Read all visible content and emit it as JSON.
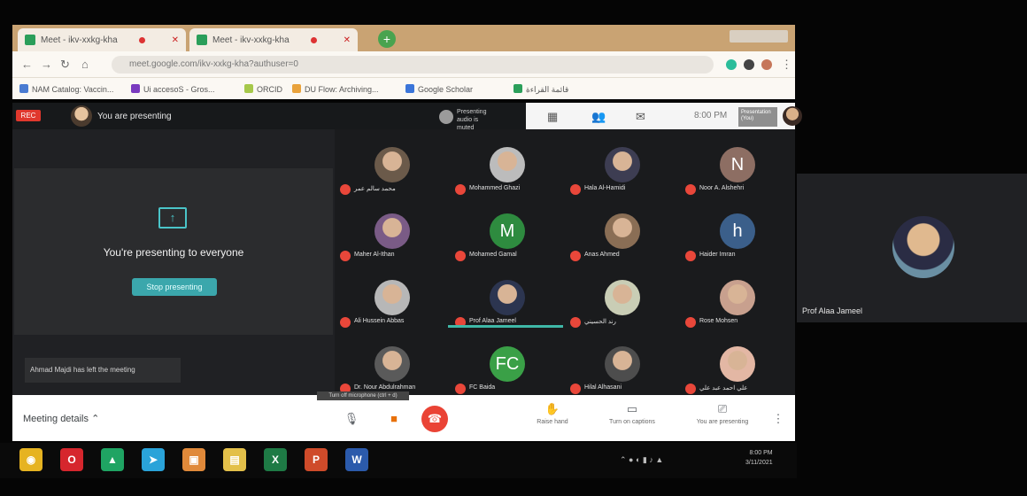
{
  "browser": {
    "tabs": [
      {
        "title": "Meet - ikv-xxkg-kha"
      },
      {
        "title": "Meet - ikv-xxkg-kha"
      }
    ],
    "new_tab_label": "+",
    "url": "meet.google.com/ikv-xxkg-kha?authuser=0",
    "bookmarks": [
      {
        "label": "NAM Catalog: Vaccin...",
        "color": "#4a7bd1"
      },
      {
        "label": "Ui accesoS - Gros...",
        "color": "#7a3bbf"
      },
      {
        "label": "ORCID",
        "color": "#a6c84a"
      },
      {
        "label": "DU Flow: Archiving...",
        "color": "#e9a23b"
      },
      {
        "label": "Google Scholar",
        "color": "#3b75d9"
      },
      {
        "label": "قائمة القراءة",
        "color": "#2b9f5a"
      }
    ]
  },
  "meet": {
    "rec_label": "REC",
    "presenting_header": "You are presenting",
    "audio_chip": "Presenting audio is muted",
    "clock": "8:00 PM",
    "presentation_chip": "Presentation (You)",
    "present_message": "You're presenting to everyone",
    "stop_button": "Stop presenting",
    "toast": "Ahmad Majdi has left the meeting",
    "meeting_details": "Meeting details",
    "tooltip": "Turn off microphone (ctrl + d)",
    "right_labels": {
      "raise": "Raise hand",
      "captions": "Turn on captions",
      "present": "You are presenting"
    },
    "pinned_name": "Prof Alaa Jameel",
    "participants": [
      {
        "name": "محمد سالم عمر",
        "letter": "",
        "bg": "#6b5a4a"
      },
      {
        "name": "Mohammed Ghazi",
        "letter": "",
        "bg": "#bcbcbc"
      },
      {
        "name": "Hala Al-Hamidi",
        "letter": "",
        "bg": "#3d3d52"
      },
      {
        "name": "Noor A. Alshehri",
        "letter": "N",
        "bg": "#8d6e63"
      },
      {
        "name": "Maher Al-Ithan",
        "letter": "",
        "bg": "#7a5b86"
      },
      {
        "name": "Mohamed Gamal",
        "letter": "M",
        "bg": "#2e8b3f"
      },
      {
        "name": "Anas Ahmed",
        "letter": "",
        "bg": "#8a6e55"
      },
      {
        "name": "Haider Imran",
        "letter": "h",
        "bg": "#3b5f8a"
      },
      {
        "name": "Ali Hussein Abbas",
        "letter": "",
        "bg": "#b7b7b7"
      },
      {
        "name": "Prof Alaa Jameel",
        "letter": "",
        "bg": "#2c3550"
      },
      {
        "name": "رند الحسيني",
        "letter": "",
        "bg": "#c9cdb5"
      },
      {
        "name": "Rose Mohsen",
        "letter": "",
        "bg": "#c8a08e"
      },
      {
        "name": "Dr. Nour Abdulrahman",
        "letter": "",
        "bg": "#5a5a5a"
      },
      {
        "name": "FC Baida",
        "letter": "FC",
        "bg": "#3aa047"
      },
      {
        "name": "Hilal Alhasani",
        "letter": "",
        "bg": "#4d4d4d"
      },
      {
        "name": "علي احمد عبد علي",
        "letter": "",
        "bg": "#e3b7a4"
      }
    ]
  },
  "taskbar": {
    "apps": [
      {
        "icon": "chrome-icon",
        "color": "#e6b321"
      },
      {
        "icon": "opera-icon",
        "color": "#d6262d"
      },
      {
        "icon": "drive-icon",
        "color": "#1fa463"
      },
      {
        "icon": "telegram-icon",
        "color": "#2aa3d9"
      },
      {
        "icon": "photos-icon",
        "color": "#e0893a"
      },
      {
        "icon": "explorer-icon",
        "color": "#e3c04a"
      },
      {
        "icon": "excel-icon",
        "color": "#1e7a45"
      },
      {
        "icon": "powerpoint-icon",
        "color": "#cf4b2a"
      },
      {
        "icon": "word-icon",
        "color": "#2b5aab"
      }
    ],
    "time": "8:00 PM",
    "date": "3/11/2021"
  }
}
